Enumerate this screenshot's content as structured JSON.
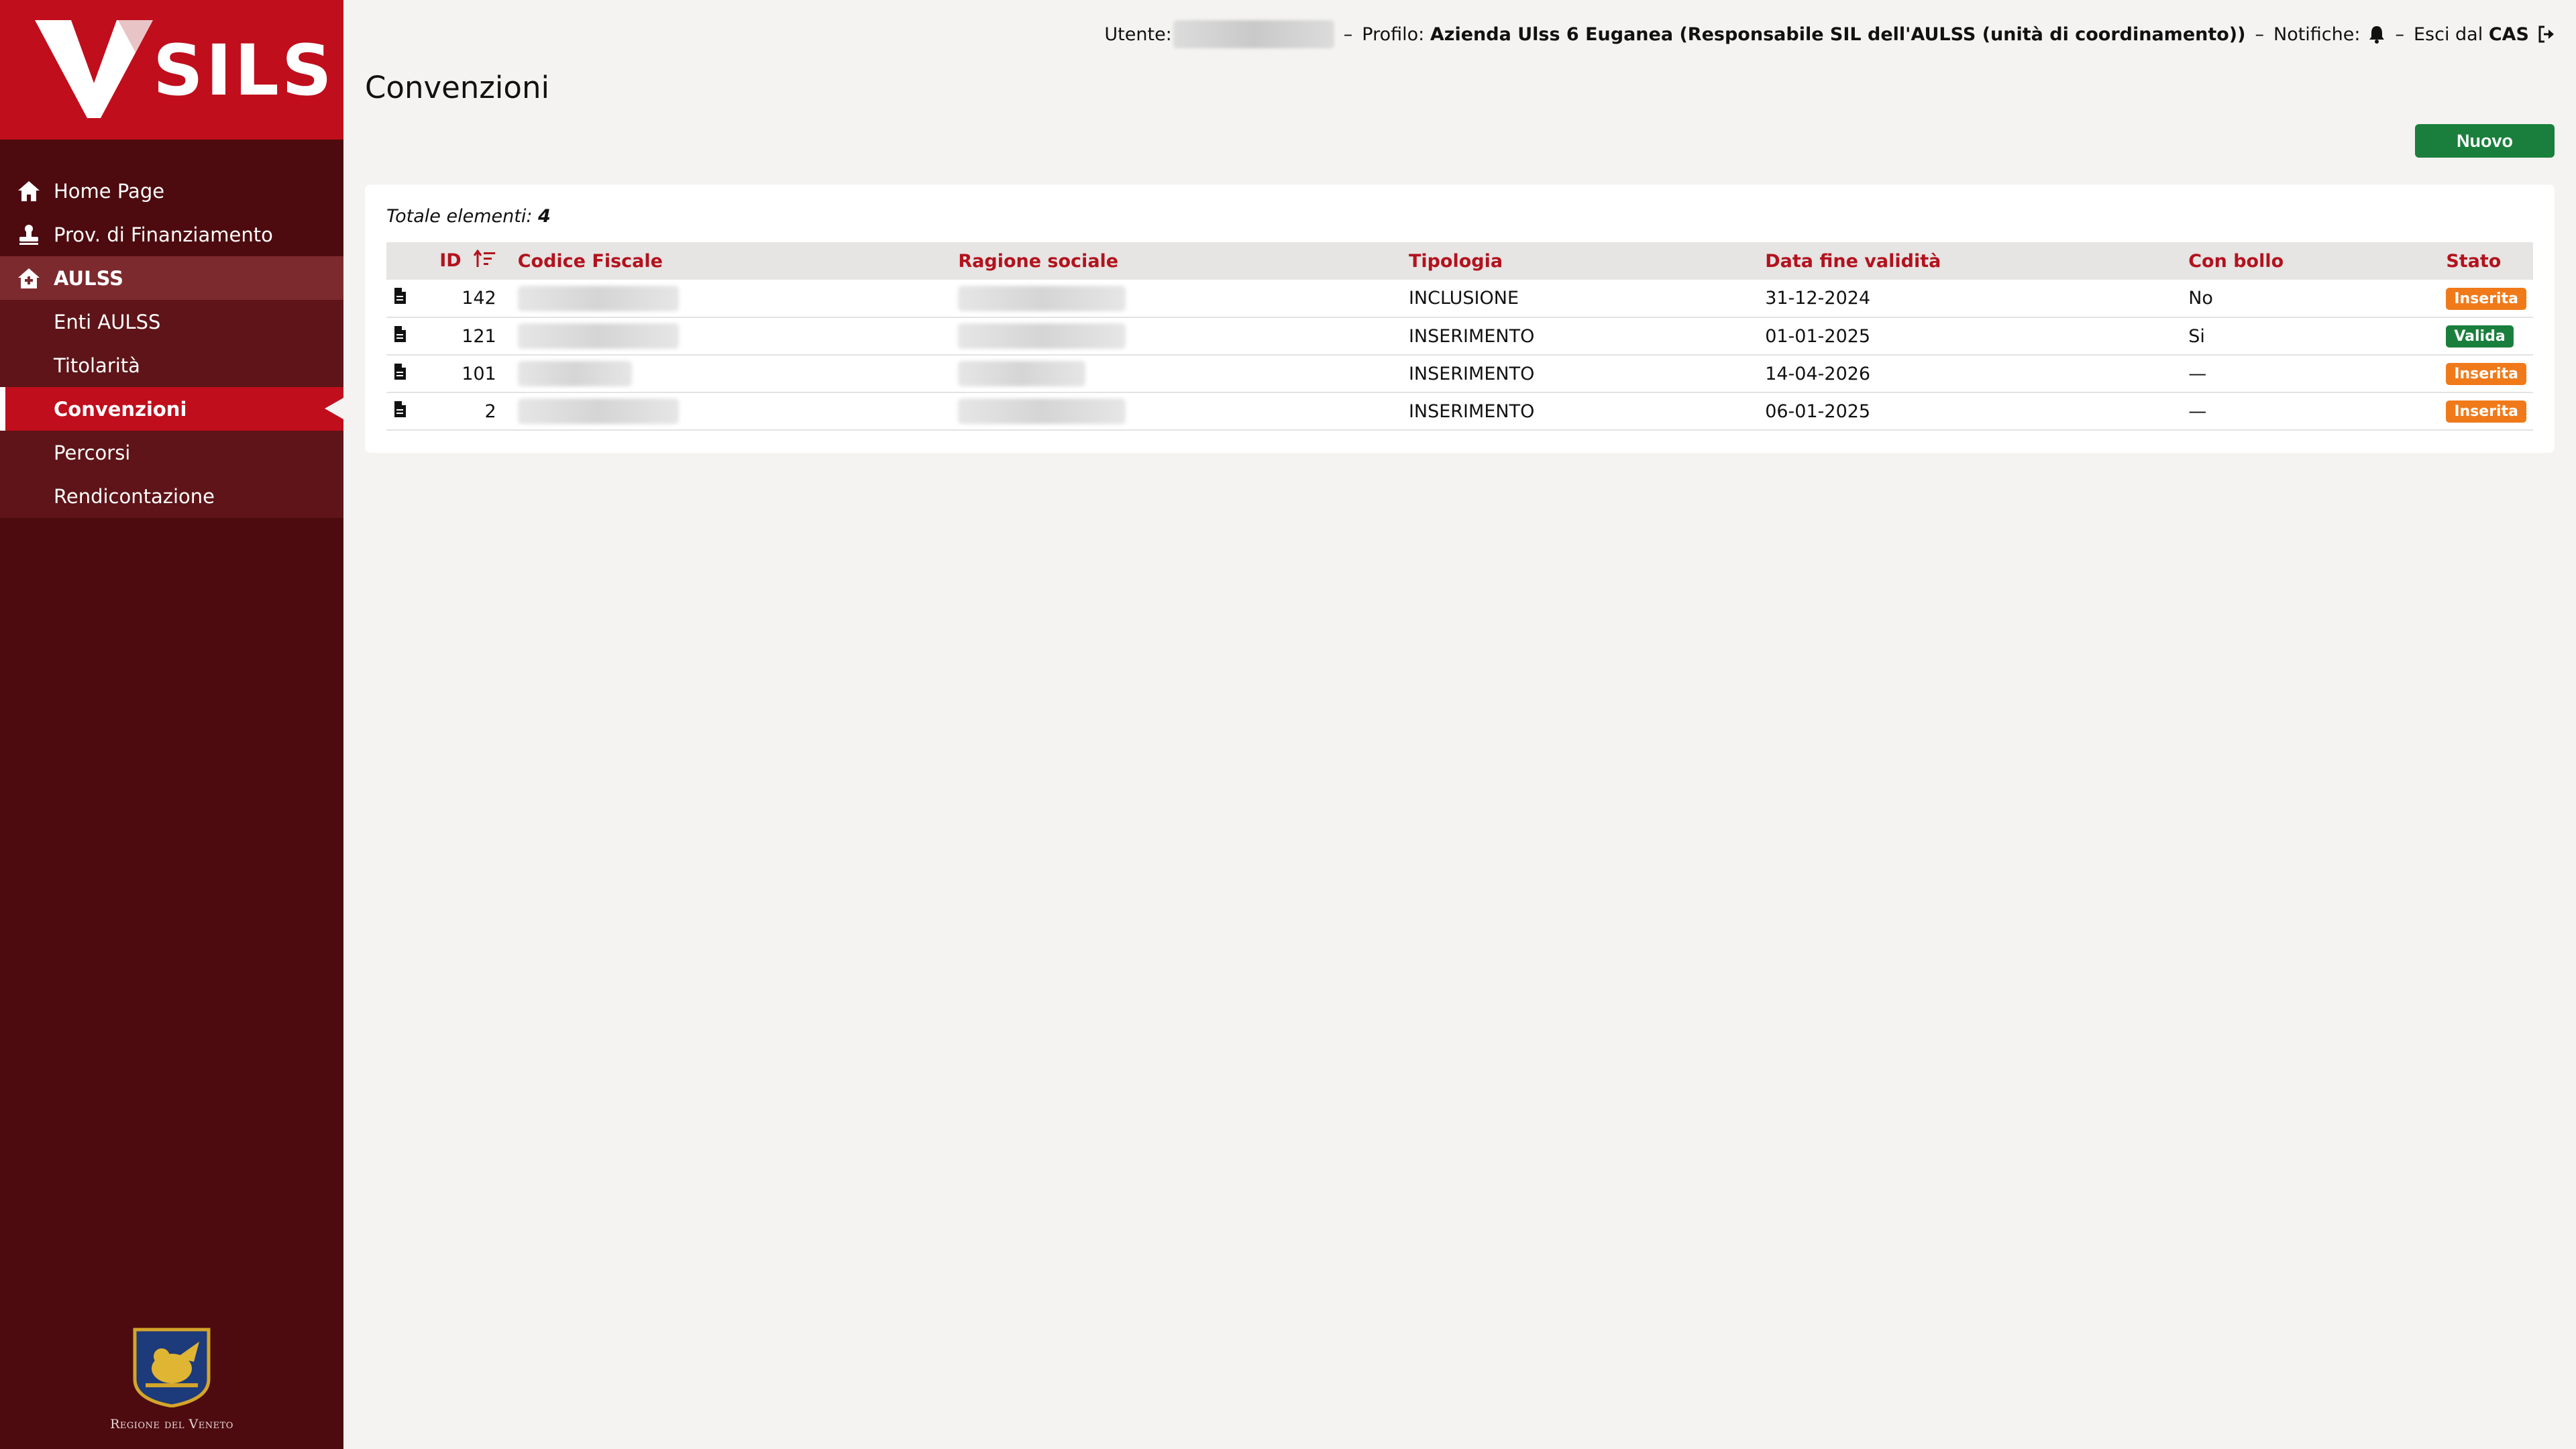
{
  "app": {
    "logo_text": "SILS",
    "region_label": "Regione del Veneto"
  },
  "header": {
    "user_label": "Utente:",
    "separator": "–",
    "profile_label": "Profilo:",
    "profile_value": "Azienda Ulss 6 Euganea (Responsabile SIL dell'AULSS (unità di coordinamento))",
    "notifications_label": "Notifiche:",
    "logout_prefix": "Esci dal",
    "logout_strong": "CAS"
  },
  "sidebar": {
    "items": [
      {
        "label": "Home Page",
        "icon": "home-icon"
      },
      {
        "label": "Prov. di Finanziamento",
        "icon": "stamp-icon"
      },
      {
        "label": "AULSS",
        "icon": "hospital-icon"
      }
    ],
    "subitems": [
      {
        "label": "Enti AULSS"
      },
      {
        "label": "Titolarità"
      },
      {
        "label": "Convenzioni"
      },
      {
        "label": "Percorsi"
      },
      {
        "label": "Rendicontazione"
      }
    ]
  },
  "page": {
    "title": "Convenzioni",
    "new_button": "Nuovo",
    "total_label": "Totale elementi:",
    "total_value": "4"
  },
  "table": {
    "columns": [
      "ID",
      "Codice Fiscale",
      "Ragione sociale",
      "Tipologia",
      "Data fine validità",
      "Con bollo",
      "Stato"
    ],
    "rows": [
      {
        "id": "142",
        "tipologia": "INCLUSIONE",
        "data": "31-12-2024",
        "bollo": "No",
        "stato": "Inserita",
        "stato_color": "#f07a1a"
      },
      {
        "id": "121",
        "tipologia": "INSERIMENTO",
        "data": "01-01-2025",
        "bollo": "Si",
        "stato": "Valida",
        "stato_color": "#1a7f3c"
      },
      {
        "id": "101",
        "tipologia": "INSERIMENTO",
        "data": "14-04-2026",
        "bollo": "—",
        "stato": "Inserita",
        "stato_color": "#f07a1a"
      },
      {
        "id": "2",
        "tipologia": "INSERIMENTO",
        "data": "06-01-2025",
        "bollo": "—",
        "stato": "Inserita",
        "stato_color": "#f07a1a"
      }
    ]
  },
  "colors": {
    "brand_red": "#c00e1c",
    "sidebar_dark": "#4d0b0f",
    "header_text": "#b3121e",
    "success": "#1a7f3c",
    "warning": "#f07a1a"
  }
}
